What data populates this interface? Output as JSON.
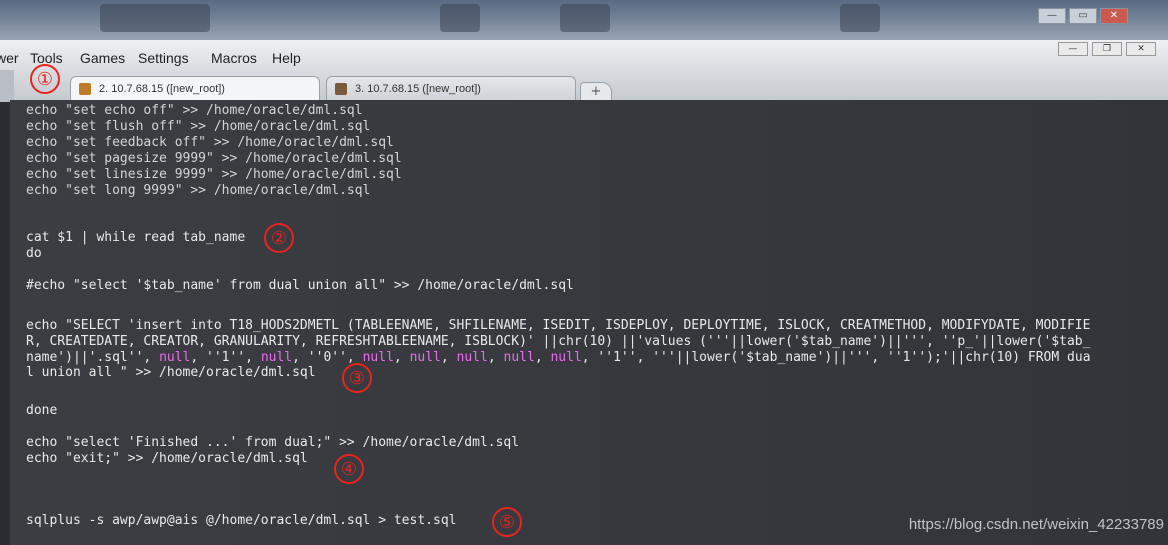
{
  "menu": {
    "items": [
      "wer",
      "Tools",
      "Games",
      "Settings",
      "Macros",
      "Help"
    ]
  },
  "window_controls": {
    "minimize": "—",
    "maximize": "▭",
    "close": "✕"
  },
  "tabs": [
    {
      "label": "2. 10.7.68.15 ([new_root])",
      "active": true
    },
    {
      "label": "3. 10.7.68.15 ([new_root])",
      "active": false
    }
  ],
  "new_tab_label": "+",
  "terminal": {
    "lines": [
      "echo \"set echo off\" >> /home/oracle/dml.sql",
      "echo \"set flush off\" >> /home/oracle/dml.sql",
      "echo \"set feedback off\" >> /home/oracle/dml.sql",
      "echo \"set pagesize 9999\" >> /home/oracle/dml.sql",
      "echo \"set linesize 9999\" >> /home/oracle/dml.sql",
      "echo \"set long 9999\" >> /home/oracle/dml.sql",
      "cat $1 | while read tab_name",
      "do",
      "#echo \"select '$tab_name' from dual union all\" >> /home/oracle/dml.sql",
      "echo \"SELECT 'insert into T18_HODS2DMETL (TABLEENAME, SHFILENAME, ISEDIT, ISDEPLOY, DEPLOYTIME, ISLOCK, CREATMETHOD, MODIFYDATE, MODIFIE",
      "R, CREATEDATE, CREATOR, GRANULARITY, REFRESHTABLEENAME, ISBLOCK)' ||chr(10) ||'values ('''||lower('$tab_name')||''', ''p_'||lower('$tab_",
      "name')||'.sql'', null, ''1'', null, ''0'', null, null, null, null, null, ''1'', '''||lower('$tab_name')||''', ''1'');'||chr(10) FROM dua",
      "l union all \" >> /home/oracle/dml.sql",
      "done",
      "echo \"select 'Finished ...' from dual;\" >> /home/oracle/dml.sql",
      "echo \"exit;\" >> /home/oracle/dml.sql",
      "sqlplus -s awp/awp@ais @/home/oracle/dml.sql > test.sql"
    ]
  },
  "markers": [
    "①",
    "②",
    "③",
    "④",
    "⑤"
  ],
  "watermark": "https://blog.csdn.net/weixin_42233789",
  "colors": {
    "terminal_bg": "#35373d",
    "text": "#e9e9e9",
    "null_keyword": "#e86bf0",
    "marker": "#e8241c"
  }
}
